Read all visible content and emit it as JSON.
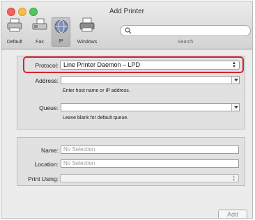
{
  "window": {
    "title": "Add Printer"
  },
  "toolbar": {
    "tools": [
      {
        "label": "Default",
        "icon": "default-printer-icon"
      },
      {
        "label": "Fax",
        "icon": "fax-icon"
      },
      {
        "label": "IP",
        "icon": "ip-globe-icon"
      },
      {
        "label": "Windows",
        "icon": "windows-printer-icon"
      }
    ],
    "selected_tool": "IP",
    "search_label": "Search"
  },
  "connection": {
    "protocol_label": "Protocol:",
    "protocol_value": "Line Printer Daemon – LPD",
    "address_label": "Address:",
    "address_value": "",
    "address_hint": "Enter host name or IP address.",
    "queue_label": "Queue:",
    "queue_value": "",
    "queue_hint": "Leave blank for default queue."
  },
  "details": {
    "name_label": "Name:",
    "name_placeholder": "No Selection",
    "location_label": "Location:",
    "location_placeholder": "No Selection",
    "print_using_label": "Print Using:",
    "print_using_value": ""
  },
  "footer": {
    "add_label": "Add"
  },
  "colors": {
    "highlight": "#d7232c",
    "close": "#f0625a",
    "minimize": "#f7be4c",
    "zoom": "#55c55e"
  }
}
